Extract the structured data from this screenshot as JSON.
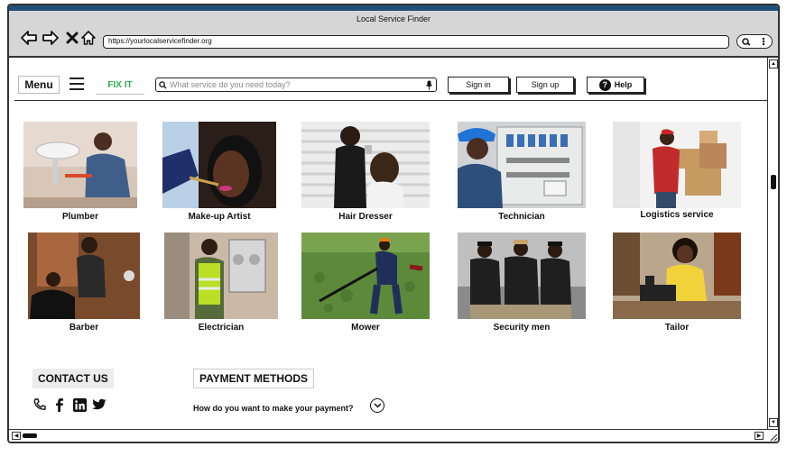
{
  "window": {
    "title": "Local Service Finder",
    "url": "https://yourlocalservicefinder.org"
  },
  "header": {
    "menu_label": "Menu",
    "brand": "FIX IT",
    "search_placeholder": "What service do you need today?",
    "sign_in": "Sign in",
    "sign_up": "Sign up",
    "help": "Help",
    "brand_color": "#2fa84f"
  },
  "services": [
    {
      "label": "Plumber"
    },
    {
      "label": "Make-up Artist"
    },
    {
      "label": "Hair Dresser"
    },
    {
      "label": "Technician"
    },
    {
      "label": "Logistics service"
    },
    {
      "label": "Barber"
    },
    {
      "label": "Electrician"
    },
    {
      "label": "Mower"
    },
    {
      "label": "Security men"
    },
    {
      "label": "Tailor"
    }
  ],
  "footer": {
    "contact_title": "CONTACT US",
    "payment_title": "PAYMENT METHODS",
    "payment_question": "How do you want to make your payment?",
    "social_icons": [
      "phone-icon",
      "facebook-icon",
      "linkedin-icon",
      "twitter-icon"
    ]
  }
}
